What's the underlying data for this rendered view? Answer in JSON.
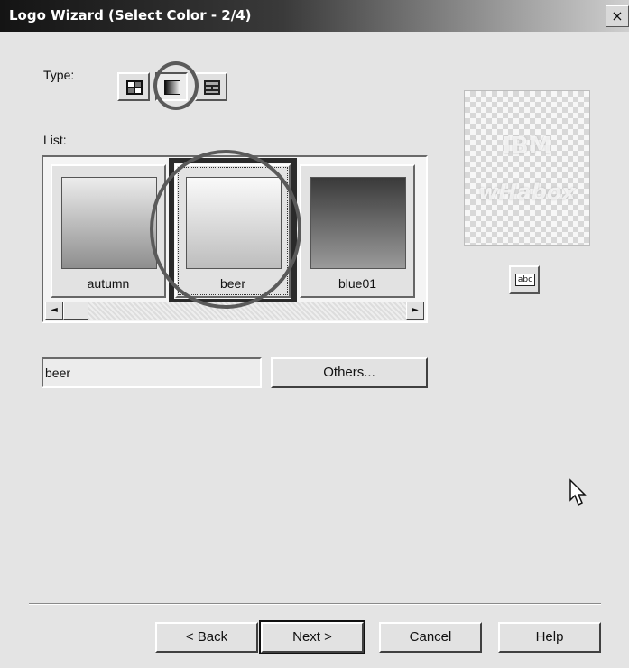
{
  "window": {
    "title": "Logo Wizard (Select Color - 2/4)",
    "close_glyph": "×"
  },
  "type_section": {
    "label": "Type:",
    "buttons": [
      {
        "name": "pattern-grid-icon",
        "selected": false
      },
      {
        "name": "gradient-icon",
        "selected": true
      },
      {
        "name": "texture-brick-icon",
        "selected": false
      }
    ]
  },
  "list_section": {
    "label": "List:",
    "items": [
      {
        "label": "autumn",
        "gradient_top": "#ececec",
        "gradient_bottom": "#8e8e8e"
      },
      {
        "label": "beer",
        "gradient_top": "#fafafa",
        "gradient_bottom": "#bdbdbd",
        "selected": true
      },
      {
        "label": "blue01",
        "gradient_top": "#3a3a3a",
        "gradient_bottom": "#9a9a9a"
      }
    ],
    "scroll_left_glyph": "◄",
    "scroll_right_glyph": "►"
  },
  "preview": {
    "line1": "IBM",
    "line2": "wHabox",
    "text_style_button_icon": "abc"
  },
  "name_field": {
    "value": "beer"
  },
  "others_button": {
    "label": "Others..."
  },
  "footer": {
    "back_label": "< Back",
    "next_label": "Next >",
    "cancel_label": "Cancel",
    "help_label": "Help"
  }
}
